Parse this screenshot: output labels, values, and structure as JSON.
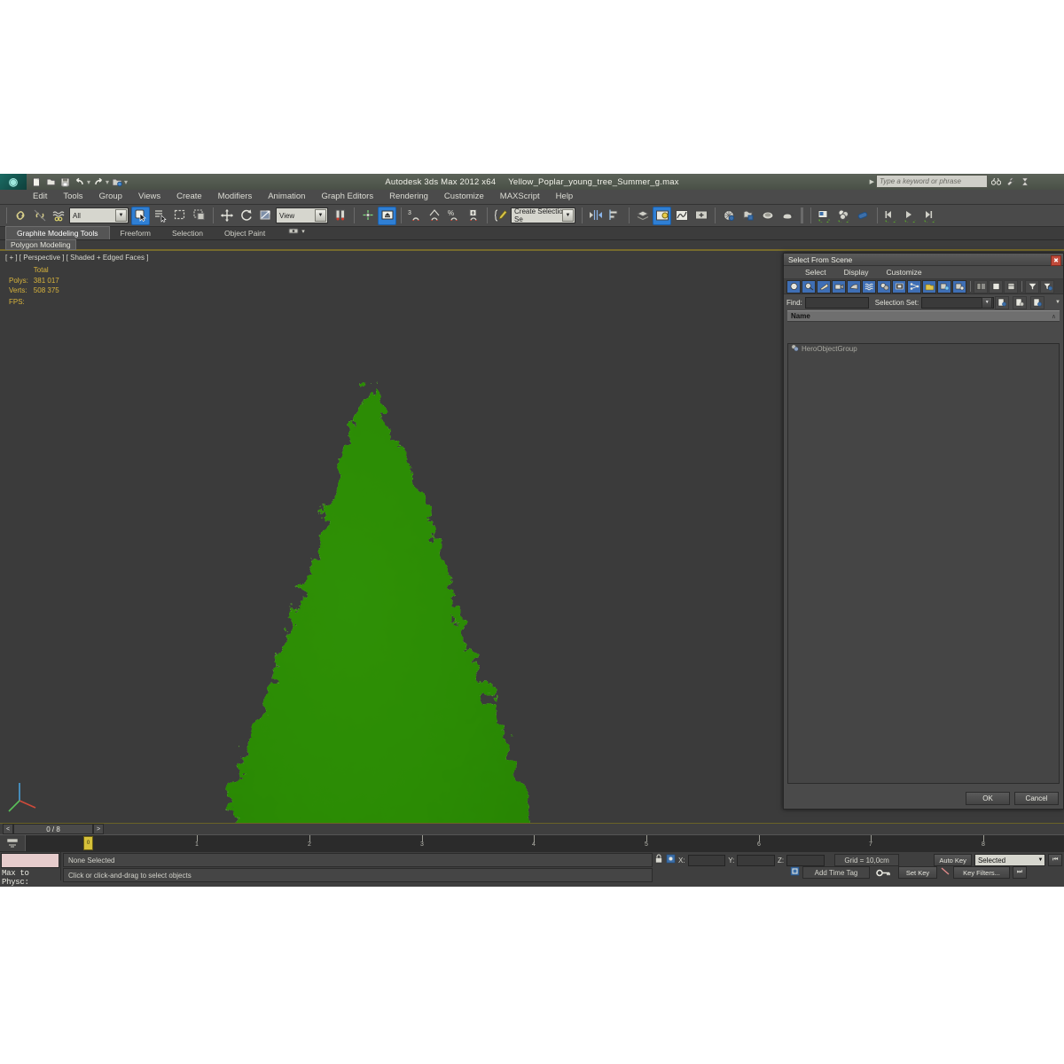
{
  "titlebar": {
    "app_title": "Autodesk 3ds Max  2012 x64",
    "file_name": "Yellow_Poplar_young_tree_Summer_g.max",
    "search_placeholder": "Type a keyword or phrase",
    "quick_access": [
      {
        "name": "new-file",
        "glyph": "⬜"
      },
      {
        "name": "open-file",
        "glyph": "▷"
      },
      {
        "name": "save-file",
        "glyph": "▣"
      },
      {
        "name": "undo",
        "glyph": "↶"
      },
      {
        "name": "redo",
        "glyph": "↷"
      },
      {
        "name": "set-project-folder",
        "glyph": "▤"
      }
    ],
    "icons": [
      {
        "name": "search-binoculars-icon",
        "glyph": "♎"
      },
      {
        "name": "wrench-icon",
        "glyph": "⚒"
      },
      {
        "name": "help-icon",
        "glyph": "⚒"
      }
    ]
  },
  "menubar": {
    "items": [
      "Edit",
      "Tools",
      "Group",
      "Views",
      "Create",
      "Modifiers",
      "Animation",
      "Graph Editors",
      "Rendering",
      "Customize",
      "MAXScript",
      "Help"
    ]
  },
  "toolbar": {
    "selection_filter": "All",
    "reference_coord": "View",
    "named_selection_set": "Create Selection Se",
    "angle_snap_value": "3"
  },
  "ribbon": {
    "tabs": [
      "Graphite Modeling Tools",
      "Freeform",
      "Selection",
      "Object Paint"
    ],
    "active_tab": "Graphite Modeling Tools",
    "subtab": "Polygon Modeling"
  },
  "viewport": {
    "label": "[ + ] [ Perspective ] [ Shaded + Edged Faces ]",
    "stats": {
      "header": "Total",
      "polys_label": "Polys:",
      "polys_value": "381 017",
      "verts_label": "Verts:",
      "verts_value": "508 375",
      "fps_label": "FPS:"
    },
    "background_color": "#3b3b3b",
    "foliage_color": "#4ca81e",
    "trunk_color": "#57a82a"
  },
  "dialog": {
    "title": "Select From Scene",
    "menu": [
      "Select",
      "Display",
      "Customize"
    ],
    "close_label": "✖",
    "filter_buttons": [
      "geometry-filter",
      "shapes-filter",
      "lights-filter",
      "cameras-filter",
      "helpers-filter",
      "space-warps-filter",
      "groups-filter",
      "xrefs-filter",
      "bones-filter",
      "containers-filter",
      "frozen-filter",
      "hidden-filter"
    ],
    "display_buttons": [
      "display-children-icon",
      "expand-all-icon",
      "collapse-all-icon"
    ],
    "filter_tools": [
      "filter-funnel-icon",
      "clear-filter-icon"
    ],
    "find_label": "Find:",
    "find_value": "",
    "selection_set_label": "Selection Set:",
    "selection_set_value": "",
    "set_buttons": [
      "add-selection-set-icon",
      "remove-selection-set-icon",
      "edit-selection-set-icon"
    ],
    "column_header": "Name",
    "sort_marker": "∧",
    "items": [
      {
        "name": "HeroObjectGroup",
        "icon": "group-icon"
      }
    ],
    "ok_label": "OK",
    "cancel_label": "Cancel"
  },
  "timeline": {
    "frame_readout": "0 / 8",
    "prev_label": "<",
    "next_label": ">",
    "ticks": [
      "1",
      "2",
      "3",
      "4",
      "5",
      "6",
      "7",
      "8"
    ],
    "playhead_label": "0"
  },
  "statusbar": {
    "max_to_physc": "Max to Physc:",
    "selection_status": "None Selected",
    "prompt": "Click or click-and-drag to select objects",
    "x_label": "X:",
    "y_label": "Y:",
    "z_label": "Z:",
    "x_value": "",
    "y_value": "",
    "z_value": "",
    "grid": "Grid = 10,0cm",
    "add_time_tag": "Add Time Tag",
    "auto_key": "Auto Key",
    "set_key": "Set Key",
    "key_mode": "Selected",
    "key_filters": "Key Filters...",
    "lock_icon": "lock-icon",
    "absolute_mode_icon": "absolute-relative-icon",
    "time_tag_icon": "time-tag-icon",
    "key_icon": "key-icon"
  }
}
